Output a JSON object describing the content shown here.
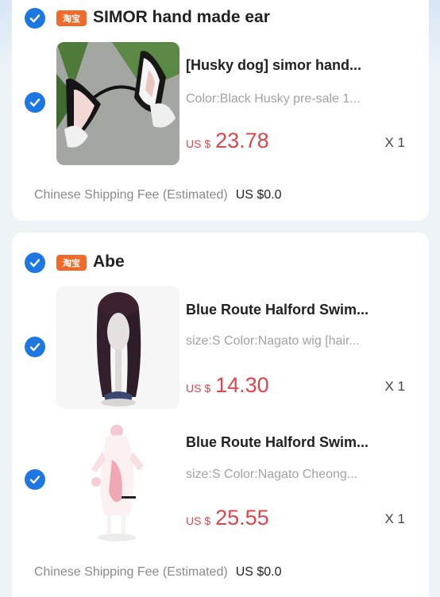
{
  "stores": [
    {
      "name": "SIMOR hand made ear",
      "badge": "淘宝",
      "items": [
        {
          "title": "[Husky dog] simor hand...",
          "spec": "Color:Black Husky pre-sale 1...",
          "currency": "US $",
          "price": "23.78",
          "qty": "X 1",
          "image": "cat-ear-headband"
        }
      ],
      "shipping_label": "Chinese Shipping Fee (Estimated)",
      "shipping_amount": "US $0.0"
    },
    {
      "name": "Abe",
      "badge": "淘宝",
      "items": [
        {
          "title": "Blue Route Halford Swim...",
          "spec": "size:S Color:Nagato wig [hair...",
          "currency": "US $",
          "price": "14.30",
          "qty": "X 1",
          "image": "long-dark-wig"
        },
        {
          "title": "Blue Route Halford Swim...",
          "spec": "size:S Color:Nagato Cheong...",
          "currency": "US $",
          "price": "25.55",
          "qty": "X 1",
          "image": "white-cheongsam-costume"
        }
      ],
      "shipping_label": "Chinese Shipping Fee (Estimated)",
      "shipping_amount": "US $0.0"
    }
  ],
  "colors": {
    "check": "#1c78e0",
    "price": "#e0454a",
    "taobao_badge": "#f06a2a"
  }
}
